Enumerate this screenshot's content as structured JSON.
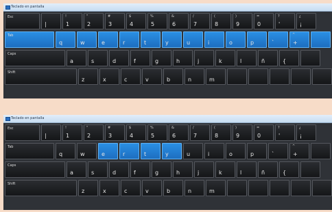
{
  "window_title": "Teclado en pantalla",
  "panels": [
    {
      "rows": [
        [
          {
            "t": "Esc",
            "w": 51,
            "type": "word"
          },
          {
            "t": "",
            "m": "|",
            "w": 29
          },
          {
            "t": "!",
            "m": "1",
            "w": 29
          },
          {
            "t": "\"",
            "m": "2",
            "w": 29
          },
          {
            "t": "#",
            "m": "3",
            "w": 29
          },
          {
            "t": "$",
            "m": "4",
            "w": 29
          },
          {
            "t": "%",
            "m": "5",
            "w": 29
          },
          {
            "t": "&",
            "m": "6",
            "w": 29
          },
          {
            "t": "/",
            "m": "7",
            "w": 29
          },
          {
            "t": "(",
            "m": "8",
            "w": 29
          },
          {
            "t": ")",
            "m": "9",
            "w": 29
          },
          {
            "t": "=",
            "m": "0",
            "w": 29
          },
          {
            "t": "?",
            "m": "'",
            "w": 29
          },
          {
            "t": "¿",
            "m": "¡",
            "w": 29
          }
        ],
        [
          {
            "t": "Tab",
            "w": 72,
            "type": "word",
            "hl": true
          },
          {
            "m": "q",
            "w": 29,
            "hl": true
          },
          {
            "m": "w",
            "w": 29,
            "hl": true
          },
          {
            "m": "e",
            "w": 29,
            "hl": true
          },
          {
            "m": "r",
            "w": 29,
            "hl": true
          },
          {
            "m": "t",
            "w": 29,
            "hl": true
          },
          {
            "m": "y",
            "w": 29,
            "hl": true
          },
          {
            "m": "u",
            "w": 29,
            "hl": true
          },
          {
            "m": "i",
            "w": 29,
            "hl": true
          },
          {
            "m": "o",
            "w": 29,
            "hl": true
          },
          {
            "m": "p",
            "w": 29,
            "hl": true
          },
          {
            "t": "",
            "m": "`",
            "w": 29,
            "hl": true
          },
          {
            "t": "^",
            "m": "+",
            "w": 29,
            "hl": true
          },
          {
            "m": "",
            "w": 29,
            "hl": true
          }
        ],
        [
          {
            "t": "Caps",
            "w": 88,
            "type": "word"
          },
          {
            "m": "a",
            "w": 29
          },
          {
            "m": "s",
            "w": 29
          },
          {
            "m": "d",
            "w": 29
          },
          {
            "m": "f",
            "w": 29
          },
          {
            "m": "g",
            "w": 29
          },
          {
            "m": "h",
            "w": 29
          },
          {
            "m": "j",
            "w": 29
          },
          {
            "m": "k",
            "w": 29
          },
          {
            "m": "l",
            "w": 29
          },
          {
            "m": "ñ",
            "w": 29
          },
          {
            "t": "",
            "m": "{",
            "w": 29
          },
          {
            "m": "",
            "w": 29
          }
        ],
        [
          {
            "t": "Shift",
            "w": 105,
            "type": "word"
          },
          {
            "m": "z",
            "w": 29
          },
          {
            "m": "x",
            "w": 29
          },
          {
            "m": "c",
            "w": 29
          },
          {
            "m": "v",
            "w": 29
          },
          {
            "m": "b",
            "w": 29
          },
          {
            "m": "n",
            "w": 29
          },
          {
            "m": "m",
            "w": 29
          },
          {
            "m": "",
            "w": 29
          },
          {
            "m": "",
            "w": 29
          },
          {
            "m": "",
            "w": 29
          },
          {
            "m": "",
            "w": 29
          },
          {
            "m": "",
            "w": 29
          }
        ]
      ]
    },
    {
      "rows": [
        [
          {
            "t": "Esc",
            "w": 51,
            "type": "word"
          },
          {
            "t": "",
            "m": "|",
            "w": 29
          },
          {
            "t": "!",
            "m": "1",
            "w": 29
          },
          {
            "t": "\"",
            "m": "2",
            "w": 29
          },
          {
            "t": "#",
            "m": "3",
            "w": 29
          },
          {
            "t": "$",
            "m": "4",
            "w": 29
          },
          {
            "t": "%",
            "m": "5",
            "w": 29
          },
          {
            "t": "&",
            "m": "6",
            "w": 29
          },
          {
            "t": "/",
            "m": "7",
            "w": 29
          },
          {
            "t": "(",
            "m": "8",
            "w": 29
          },
          {
            "t": ")",
            "m": "9",
            "w": 29
          },
          {
            "t": "=",
            "m": "0",
            "w": 29
          },
          {
            "t": "?",
            "m": "'",
            "w": 29
          },
          {
            "t": "¿",
            "m": "¡",
            "w": 29
          }
        ],
        [
          {
            "t": "Tab",
            "w": 72,
            "type": "word"
          },
          {
            "m": "q",
            "w": 29
          },
          {
            "m": "w",
            "w": 29
          },
          {
            "m": "e",
            "w": 29,
            "hl": true
          },
          {
            "m": "r",
            "w": 29,
            "hl": true
          },
          {
            "m": "t",
            "w": 29,
            "hl": true
          },
          {
            "m": "y",
            "w": 29,
            "hl": true
          },
          {
            "m": "u",
            "w": 29
          },
          {
            "m": "i",
            "w": 29
          },
          {
            "m": "o",
            "w": 29
          },
          {
            "m": "p",
            "w": 29
          },
          {
            "t": "",
            "m": "`",
            "w": 29
          },
          {
            "t": "^",
            "m": "+",
            "w": 29
          },
          {
            "m": "",
            "w": 29
          }
        ],
        [
          {
            "t": "Caps",
            "w": 88,
            "type": "word"
          },
          {
            "m": "a",
            "w": 29
          },
          {
            "m": "s",
            "w": 29
          },
          {
            "m": "d",
            "w": 29
          },
          {
            "m": "f",
            "w": 29
          },
          {
            "m": "g",
            "w": 29
          },
          {
            "m": "h",
            "w": 29
          },
          {
            "m": "j",
            "w": 29
          },
          {
            "m": "k",
            "w": 29
          },
          {
            "m": "l",
            "w": 29
          },
          {
            "m": "ñ",
            "w": 29
          },
          {
            "t": "",
            "m": "{",
            "w": 29
          },
          {
            "m": "",
            "w": 29
          }
        ],
        [
          {
            "t": "Shift",
            "w": 105,
            "type": "word"
          },
          {
            "m": "z",
            "w": 29
          },
          {
            "m": "x",
            "w": 29
          },
          {
            "m": "c",
            "w": 29
          },
          {
            "m": "v",
            "w": 29
          },
          {
            "m": "b",
            "w": 29
          },
          {
            "m": "n",
            "w": 29
          },
          {
            "m": "m",
            "w": 29
          },
          {
            "m": "",
            "w": 29
          },
          {
            "m": "",
            "w": 29
          },
          {
            "m": "",
            "w": 29
          },
          {
            "m": "",
            "w": 29
          },
          {
            "m": "",
            "w": 29
          }
        ]
      ]
    }
  ]
}
